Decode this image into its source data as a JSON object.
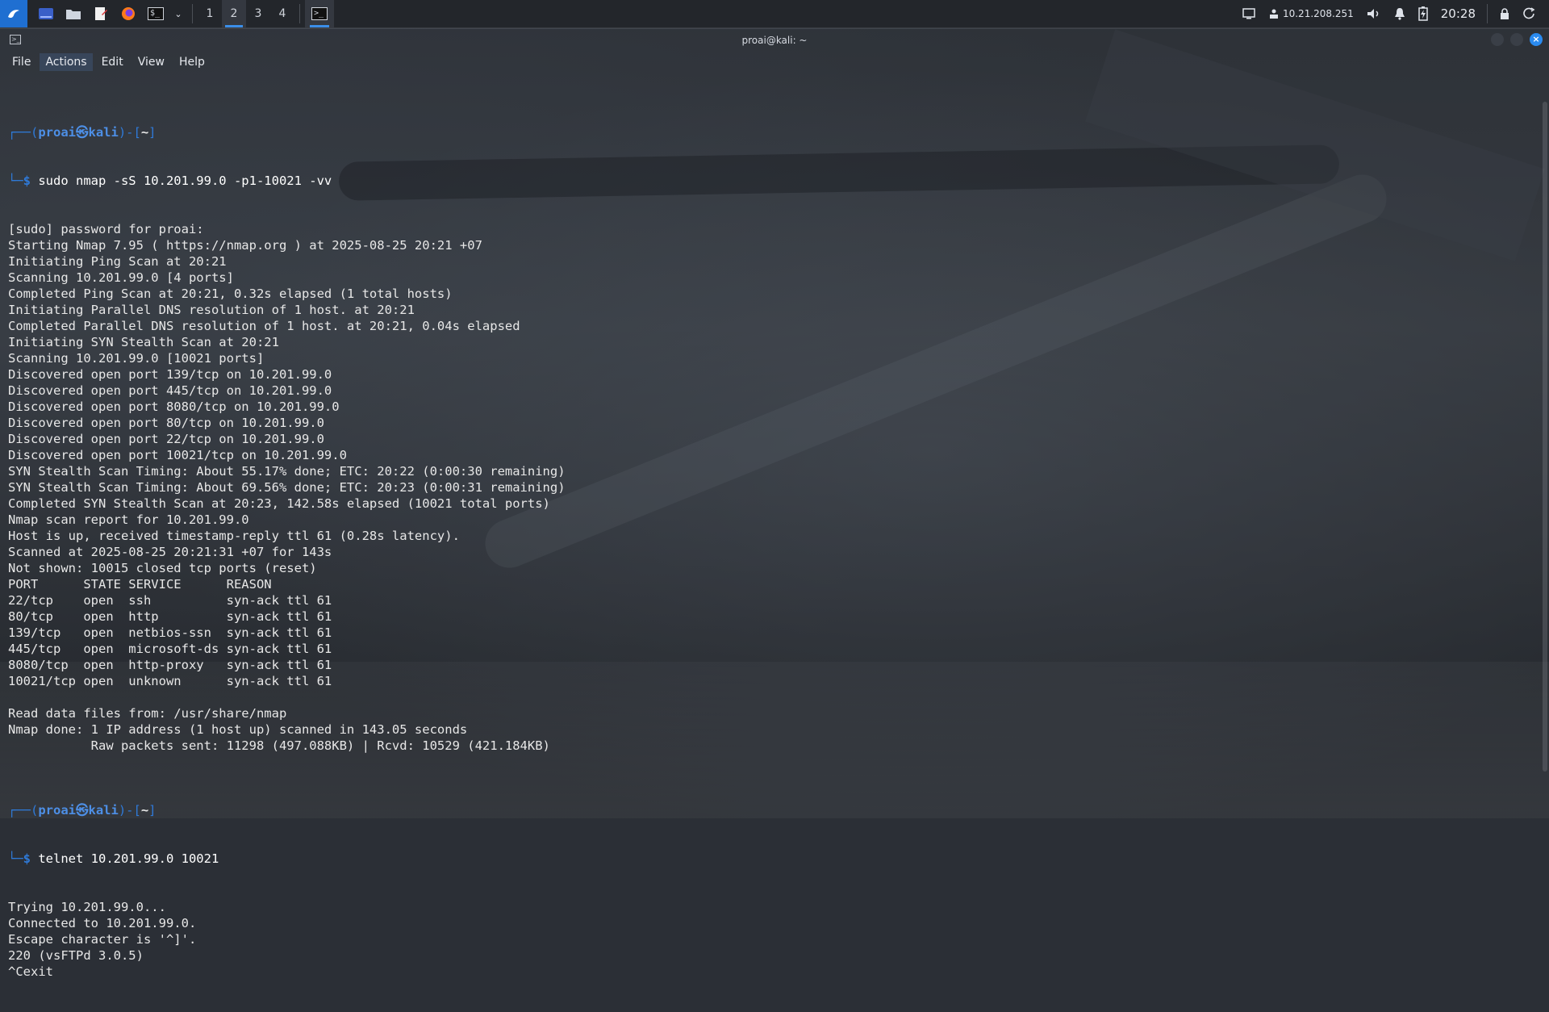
{
  "taskbar": {
    "workspaces": [
      "1",
      "2",
      "3",
      "4"
    ],
    "active_workspace": "2",
    "tray": {
      "ip": "10.21.208.251",
      "time": "20:28"
    },
    "icons": {
      "menu": "kali-dragon-icon",
      "desktop": "show-desktop-icon",
      "files": "file-manager-icon",
      "editor": "text-editor-icon",
      "browser": "firefox-icon",
      "terminal": "terminal-icon",
      "dropdown": "chevron-down-icon"
    }
  },
  "window": {
    "title": "proai@kali: ~",
    "menu": [
      "File",
      "Actions",
      "Edit",
      "View",
      "Help"
    ]
  },
  "terminal": {
    "prompt": {
      "user_host": "proai㉿kali",
      "path": "~"
    },
    "commands": [
      "sudo nmap -sS 10.201.99.0 -p1-10021 -vv",
      "telnet 10.201.99.0 10021"
    ],
    "output1": [
      "[sudo] password for proai:",
      "Starting Nmap 7.95 ( https://nmap.org ) at 2025-08-25 20:21 +07",
      "Initiating Ping Scan at 20:21",
      "Scanning 10.201.99.0 [4 ports]",
      "Completed Ping Scan at 20:21, 0.32s elapsed (1 total hosts)",
      "Initiating Parallel DNS resolution of 1 host. at 20:21",
      "Completed Parallel DNS resolution of 1 host. at 20:21, 0.04s elapsed",
      "Initiating SYN Stealth Scan at 20:21",
      "Scanning 10.201.99.0 [10021 ports]",
      "Discovered open port 139/tcp on 10.201.99.0",
      "Discovered open port 445/tcp on 10.201.99.0",
      "Discovered open port 8080/tcp on 10.201.99.0",
      "Discovered open port 80/tcp on 10.201.99.0",
      "Discovered open port 22/tcp on 10.201.99.0",
      "Discovered open port 10021/tcp on 10.201.99.0",
      "SYN Stealth Scan Timing: About 55.17% done; ETC: 20:22 (0:00:30 remaining)",
      "SYN Stealth Scan Timing: About 69.56% done; ETC: 20:23 (0:00:31 remaining)",
      "Completed SYN Stealth Scan at 20:23, 142.58s elapsed (10021 total ports)",
      "Nmap scan report for 10.201.99.0",
      "Host is up, received timestamp-reply ttl 61 (0.28s latency).",
      "Scanned at 2025-08-25 20:21:31 +07 for 143s",
      "Not shown: 10015 closed tcp ports (reset)",
      "PORT      STATE SERVICE      REASON",
      "22/tcp    open  ssh          syn-ack ttl 61",
      "80/tcp    open  http         syn-ack ttl 61",
      "139/tcp   open  netbios-ssn  syn-ack ttl 61",
      "445/tcp   open  microsoft-ds syn-ack ttl 61",
      "8080/tcp  open  http-proxy   syn-ack ttl 61",
      "10021/tcp open  unknown      syn-ack ttl 61",
      "",
      "Read data files from: /usr/share/nmap",
      "Nmap done: 1 IP address (1 host up) scanned in 143.05 seconds",
      "           Raw packets sent: 11298 (497.088KB) | Rcvd: 10529 (421.184KB)",
      ""
    ],
    "output2": [
      "Trying 10.201.99.0...",
      "Connected to 10.201.99.0.",
      "Escape character is '^]'.",
      "220 (vsFTPd 3.0.5)",
      "^Cexit"
    ]
  }
}
